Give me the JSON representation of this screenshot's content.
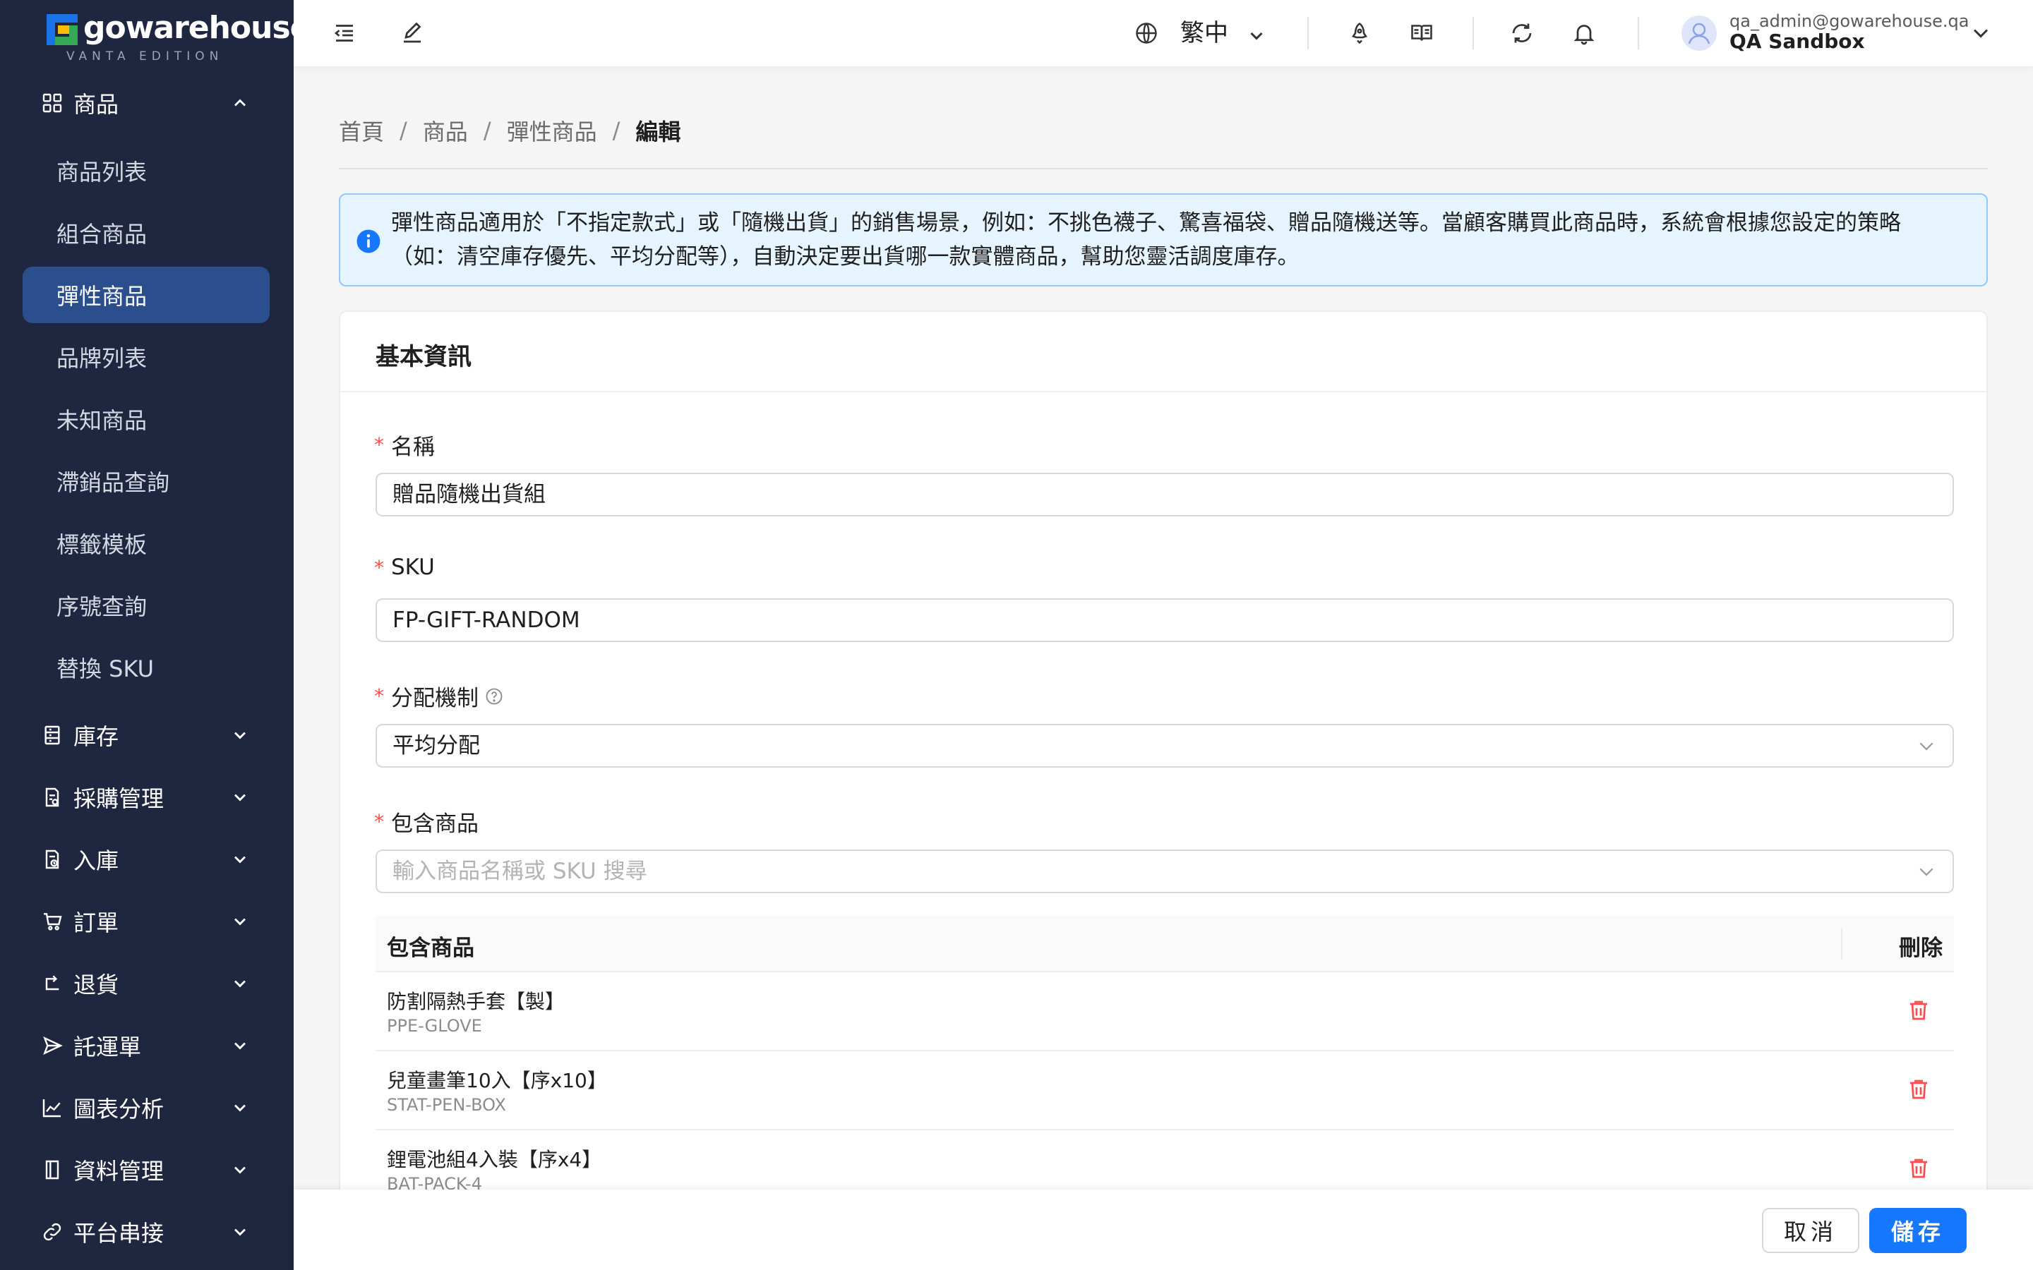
{
  "brand": {
    "name": "gowarehouse",
    "edition": "VANTA EDITION",
    "colors": {
      "blue": "#1a73e8",
      "green": "#34a853",
      "yellow": "#fbbc05"
    }
  },
  "sidebar": {
    "groups": [
      {
        "label": "商品",
        "icon": "grid-icon",
        "expanded": true
      },
      {
        "label": "庫存",
        "icon": "inventory-icon",
        "expanded": false
      },
      {
        "label": "採購管理",
        "icon": "purchase-icon",
        "expanded": false
      },
      {
        "label": "入庫",
        "icon": "inbound-icon",
        "expanded": false
      },
      {
        "label": "訂單",
        "icon": "cart-icon",
        "expanded": false
      },
      {
        "label": "退貨",
        "icon": "return-icon",
        "expanded": false
      },
      {
        "label": "託運單",
        "icon": "send-icon",
        "expanded": false
      },
      {
        "label": "圖表分析",
        "icon": "chart-icon",
        "expanded": false
      },
      {
        "label": "資料管理",
        "icon": "book-icon",
        "expanded": false
      },
      {
        "label": "平台串接",
        "icon": "link-icon",
        "expanded": false
      }
    ],
    "product_items": [
      {
        "label": "商品列表",
        "active": false
      },
      {
        "label": "組合商品",
        "active": false
      },
      {
        "label": "彈性商品",
        "active": true
      },
      {
        "label": "品牌列表",
        "active": false
      },
      {
        "label": "未知商品",
        "active": false
      },
      {
        "label": "滯銷品查詢",
        "active": false
      },
      {
        "label": "標籤模板",
        "active": false
      },
      {
        "label": "序號查詢",
        "active": false
      },
      {
        "label": "替換 SKU",
        "active": false
      }
    ]
  },
  "header": {
    "language": "繁中",
    "user_email": "qa_admin@gowarehouse.qa",
    "user_name": "QA Sandbox"
  },
  "breadcrumb": [
    "首頁",
    "商品",
    "彈性商品",
    "編輯"
  ],
  "alert": {
    "text": "彈性商品適用於「不指定款式」或「隨機出貨」的銷售場景，例如：不挑色襪子、驚喜福袋、贈品隨機送等。當顧客購買此商品時，系統會根據您設定的策略（如：清空庫存優先、平均分配等），自動決定要出貨哪一款實體商品，幫助您靈活調度庫存。"
  },
  "form": {
    "section_title": "基本資訊",
    "name_label": "名稱",
    "name_value": "贈品隨機出貨組",
    "sku_label": "SKU",
    "sku_value": "FP-GIFT-RANDOM",
    "allocation_label": "分配機制",
    "allocation_value": "平均分配",
    "included_label": "包含商品",
    "included_placeholder": "輸入商品名稱或 SKU 搜尋"
  },
  "table": {
    "col_name": "包含商品",
    "col_delete": "刪除",
    "rows": [
      {
        "name": "防割隔熱手套【製】",
        "sku": "PPE-GLOVE"
      },
      {
        "name": "兒童畫筆10入【序x10】",
        "sku": "STAT-PEN-BOX"
      },
      {
        "name": "鋰電池組4入裝【序x4】",
        "sku": "BAT-PACK-4"
      }
    ]
  },
  "footer": {
    "cancel_label": "取消",
    "save_label": "儲存"
  },
  "colors": {
    "sidebar_bg": "#1f2740",
    "sidebar_active": "#2b4e8c",
    "primary": "#1677ff",
    "danger": "#ff4d4f",
    "alert_bg": "#e6f4ff"
  }
}
